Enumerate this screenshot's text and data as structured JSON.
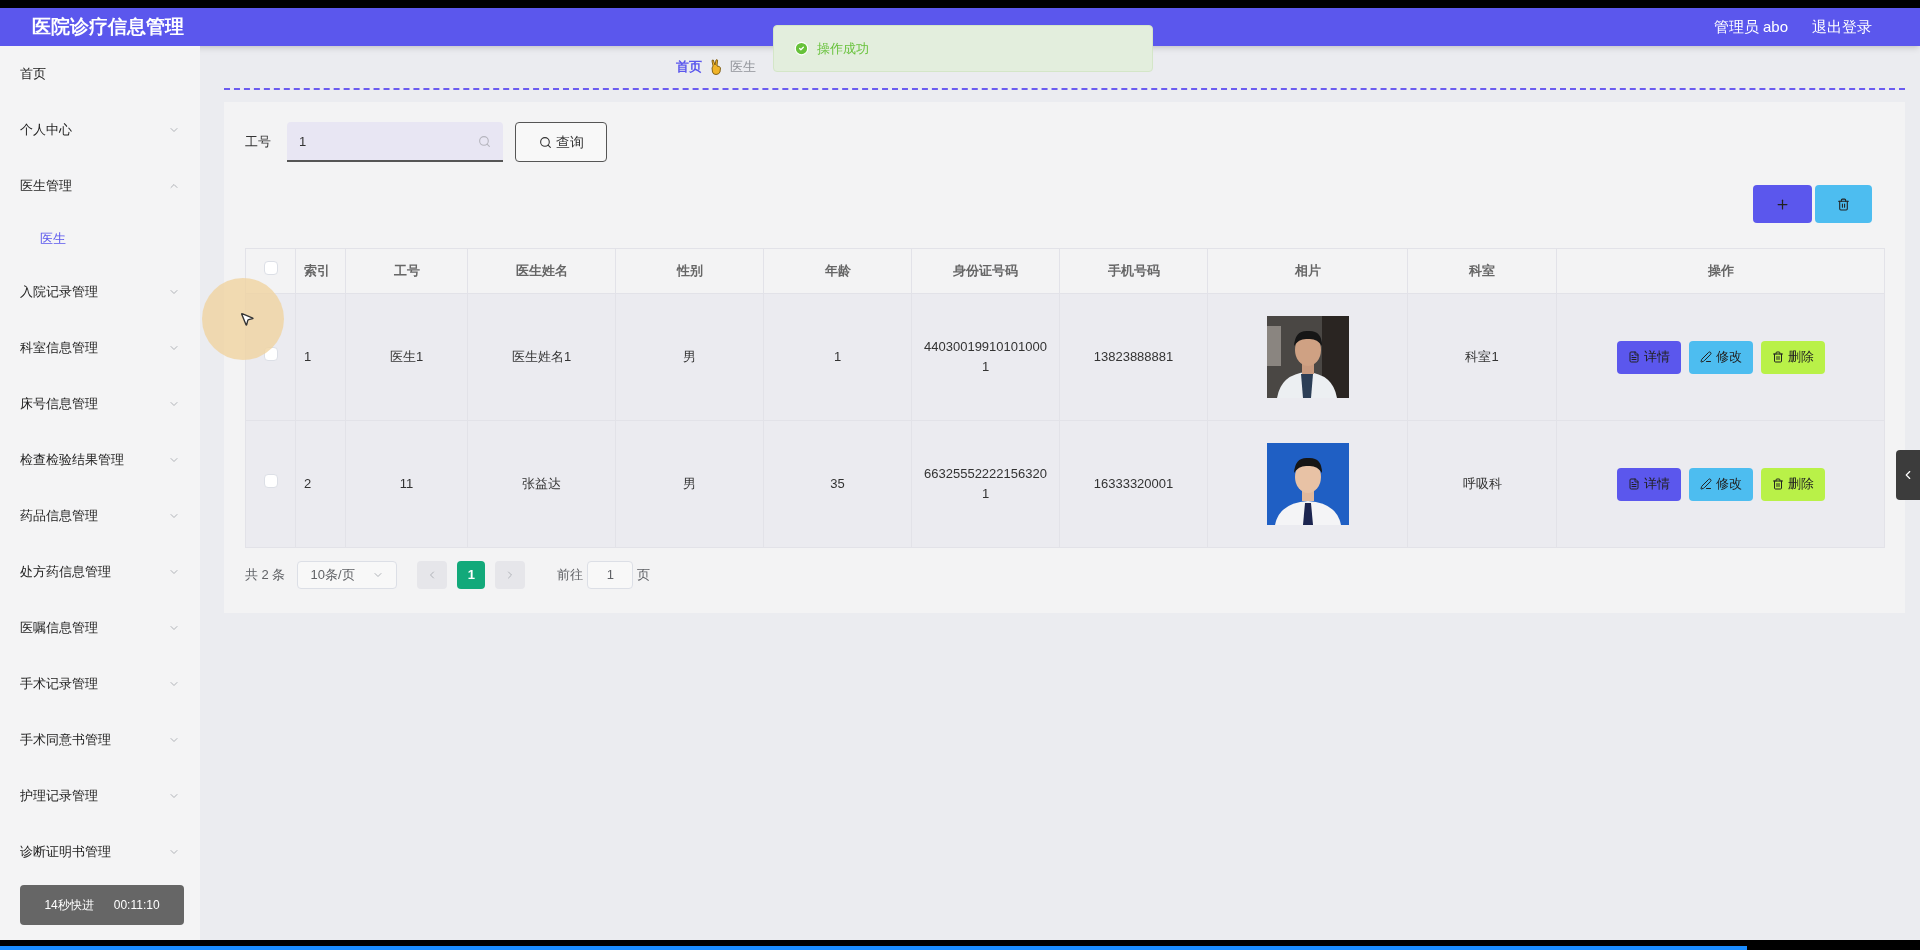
{
  "header": {
    "title": "医院诊疗信息管理",
    "user": "管理员 abo",
    "logout": "退出登录"
  },
  "toast": {
    "text": "操作成功"
  },
  "breadcrumb": [
    {
      "label": "首页",
      "selected": false
    },
    {
      "label": "医生",
      "selected": true
    }
  ],
  "sidebar": {
    "items": [
      {
        "label": "首页",
        "kind": "link"
      },
      {
        "label": "个人中心",
        "kind": "menu",
        "expanded": false
      },
      {
        "label": "医生管理",
        "kind": "menu",
        "expanded": true,
        "children": [
          {
            "label": "医生",
            "selected": true
          }
        ]
      },
      {
        "label": "入院记录管理",
        "kind": "menu",
        "expanded": false
      },
      {
        "label": "科室信息管理",
        "kind": "menu",
        "expanded": false
      },
      {
        "label": "床号信息管理",
        "kind": "menu",
        "expanded": false
      },
      {
        "label": "检查检验结果管理",
        "kind": "menu",
        "expanded": false
      },
      {
        "label": "药品信息管理",
        "kind": "menu",
        "expanded": false
      },
      {
        "label": "处方药信息管理",
        "kind": "menu",
        "expanded": false
      },
      {
        "label": "医嘱信息管理",
        "kind": "menu",
        "expanded": false
      },
      {
        "label": "手术记录管理",
        "kind": "menu",
        "expanded": false
      },
      {
        "label": "手术同意书管理",
        "kind": "menu",
        "expanded": false
      },
      {
        "label": "护理记录管理",
        "kind": "menu",
        "expanded": false
      },
      {
        "label": "诊断证明书管理",
        "kind": "menu",
        "expanded": false
      }
    ]
  },
  "search": {
    "label": "工号",
    "value": "1",
    "button": "查询"
  },
  "table": {
    "columns": [
      "索引",
      "工号",
      "医生姓名",
      "性别",
      "年龄",
      "身份证号码",
      "手机号码",
      "相片",
      "科室",
      "操作"
    ],
    "header_checked": false,
    "rows": [
      {
        "checked": false,
        "index": "1",
        "job_no": "医生1",
        "name": "医生姓名1",
        "gender": "男",
        "age": "1",
        "id_no": "440300199101010001",
        "phone": "13823888881",
        "department": "科室1",
        "actions": [
          "详情",
          "修改",
          "删除"
        ]
      },
      {
        "checked": false,
        "index": "2",
        "job_no": "11",
        "name": "张益达",
        "gender": "男",
        "age": "35",
        "id_no": "663255522221563201",
        "phone": "16333320001",
        "department": "呼吸科",
        "actions": [
          "详情",
          "修改",
          "删除"
        ]
      }
    ]
  },
  "pagination": {
    "total": "共 2 条",
    "page_size": "10条/页",
    "pages": [
      {
        "label": "1",
        "selected": true
      }
    ],
    "goto_label": "前往",
    "goto_value": "1",
    "goto_suffix": "页"
  },
  "video_overlay": {
    "text": "14秒快进",
    "time": "00:11:10",
    "level": 0.91
  }
}
